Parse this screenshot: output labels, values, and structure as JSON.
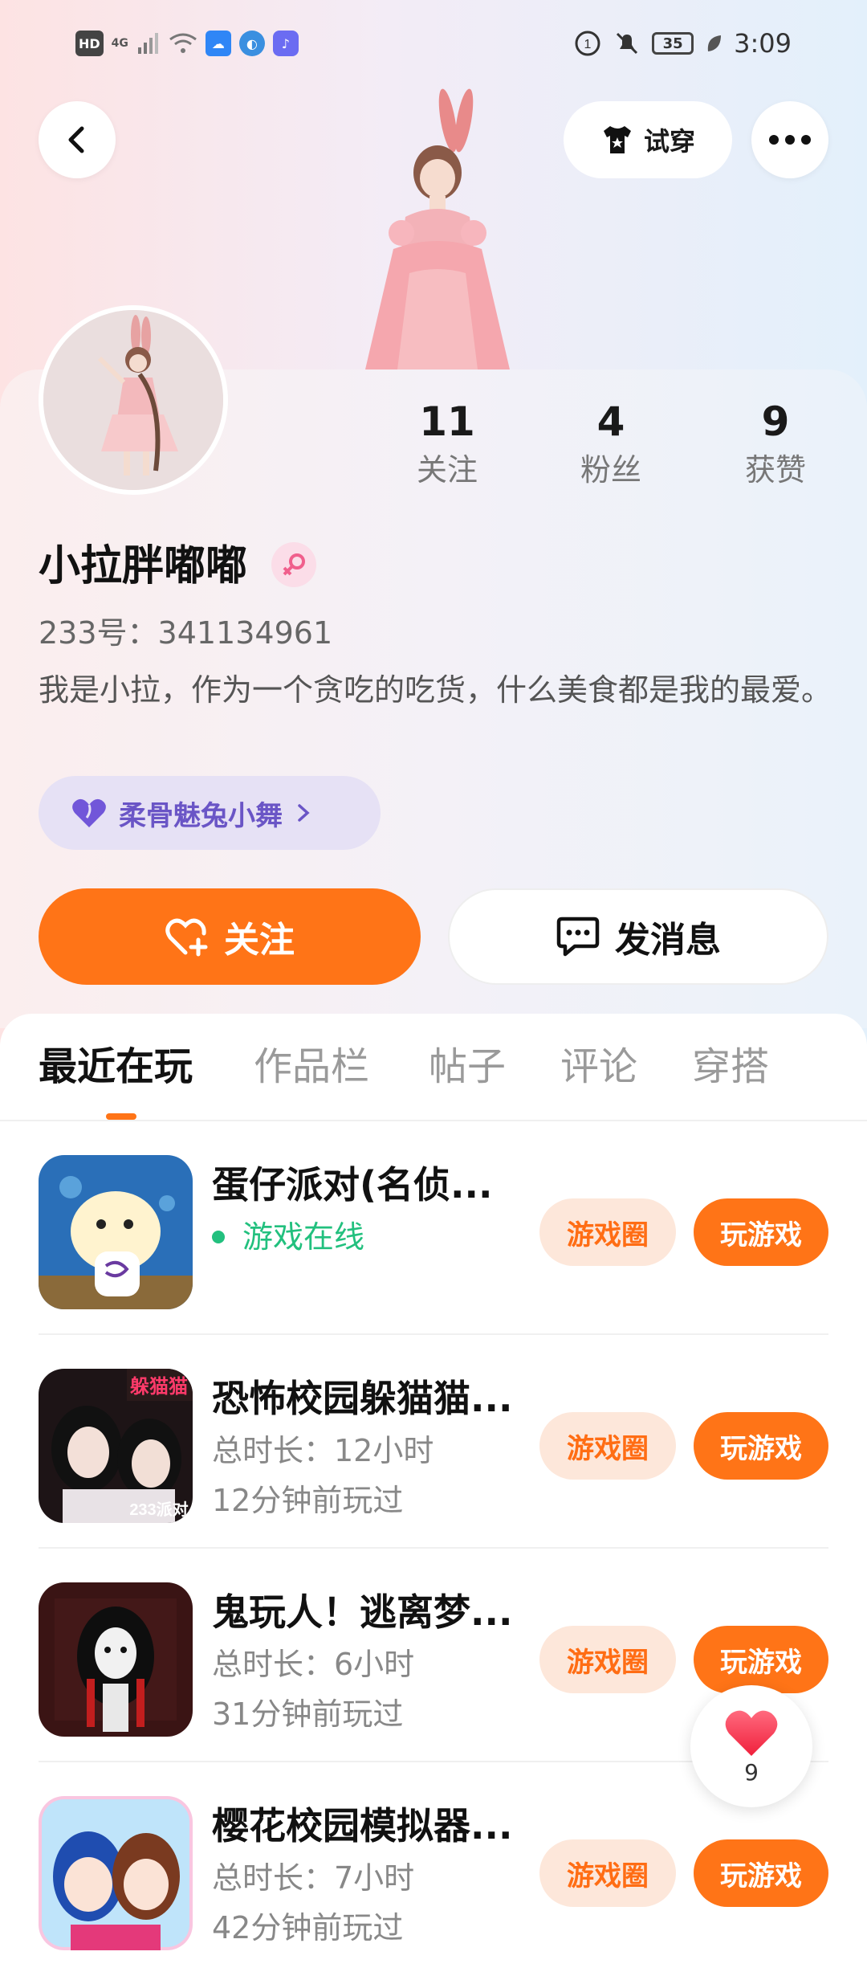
{
  "status_bar": {
    "hd": "HD",
    "network": "4G",
    "battery": "35",
    "time": "3:09"
  },
  "top_bar": {
    "try_on_label": "试穿"
  },
  "profile": {
    "stats": [
      {
        "value": "11",
        "label": "关注"
      },
      {
        "value": "4",
        "label": "粉丝"
      },
      {
        "value": "9",
        "label": "获赞"
      }
    ],
    "nickname": "小拉胖嘟嘟",
    "uid": "233号：341134961",
    "bio": "我是小拉，作为一个贪吃的吃货，什么美食都是我的最爱。",
    "dance_tag": "柔骨魅兔小舞",
    "follow_label": "关注",
    "message_label": "发消息"
  },
  "tabs": [
    {
      "label": "最近在玩",
      "active": true
    },
    {
      "label": "作品栏",
      "active": false
    },
    {
      "label": "帖子",
      "active": false
    },
    {
      "label": "评论",
      "active": false
    },
    {
      "label": "穿搭",
      "active": false
    }
  ],
  "games": [
    {
      "title": "蛋仔派对(名侦...",
      "line1": "游戏在线",
      "line2": "",
      "online": true,
      "circle_label": "游戏圈",
      "play_label": "玩游戏"
    },
    {
      "title": "恐怖校园躲猫猫...",
      "line1": "总时长：12小时",
      "line2": "12分钟前玩过",
      "online": false,
      "circle_label": "游戏圈",
      "play_label": "玩游戏"
    },
    {
      "title": "鬼玩人！逃离梦...",
      "line1": "总时长：6小时",
      "line2": "31分钟前玩过",
      "online": false,
      "circle_label": "游戏圈",
      "play_label": "玩游戏"
    },
    {
      "title": "樱花校园模拟器...",
      "line1": "总时长：7小时",
      "line2": "42分钟前玩过",
      "online": false,
      "circle_label": "游戏圈",
      "play_label": "玩游戏"
    }
  ],
  "floating_like": {
    "count": "9"
  },
  "colors": {
    "accent": "#ff7417",
    "online": "#22c07e",
    "tag_text": "#6a55c6"
  }
}
